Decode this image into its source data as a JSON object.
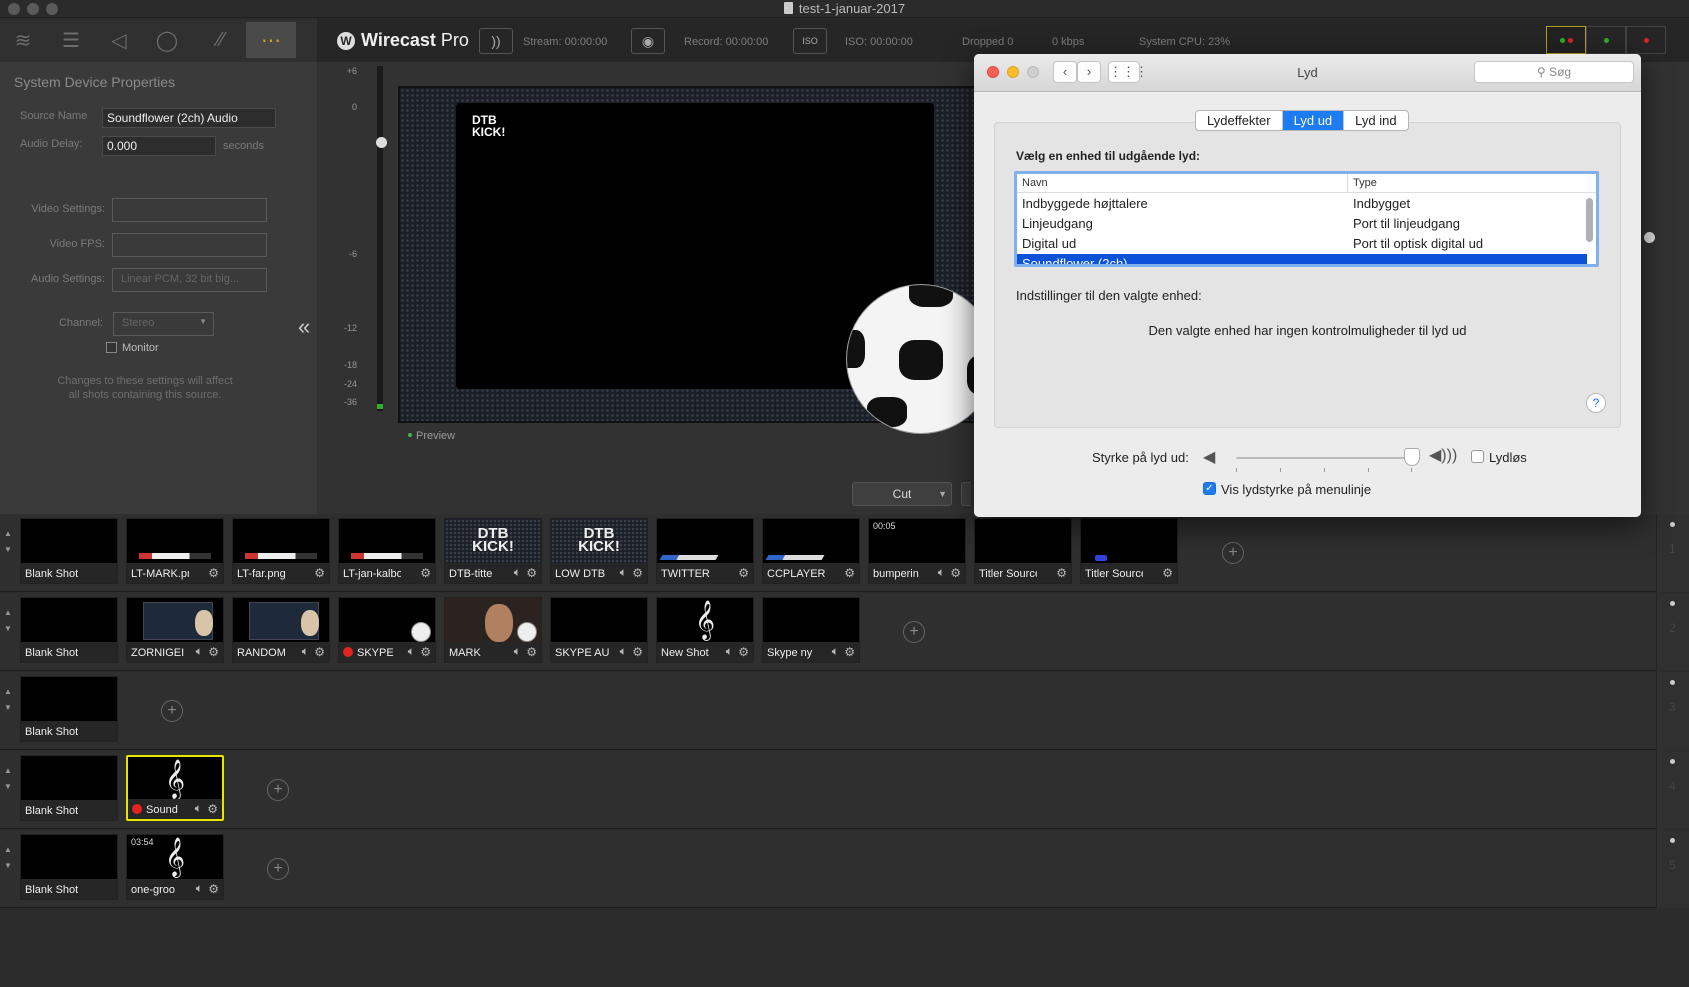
{
  "window": {
    "title": "test-1-januar-2017"
  },
  "left_panel": {
    "title": "System Device Properties",
    "source_name_label": "Source Name",
    "source_name_value": "Soundflower (2ch) Audio",
    "audio_delay_label": "Audio Delay:",
    "audio_delay_value": "0.000",
    "audio_delay_unit": "seconds",
    "video_settings_label": "Video Settings:",
    "video_fps_label": "Video FPS:",
    "audio_settings_label": "Audio Settings:",
    "audio_settings_value": "Linear PCM, 32 bit big...",
    "channel_label": "Channel:",
    "channel_value": "Stereo",
    "monitor_label": "Monitor",
    "note_line1": "Changes to these settings will affect",
    "note_line2": "all shots containing this source.",
    "collapse": "«"
  },
  "header": {
    "logo": "Wirecast",
    "logo_suffix": " Pro",
    "stream_label": "Stream:",
    "stream_time": "00:00:00",
    "record_label": "Record:",
    "record_time": "00:00:00",
    "iso_label": "ISO:",
    "iso_time": "00:00:00",
    "iso_btn": "ISO",
    "dropped": "Dropped 0",
    "kbps": "0 kbps",
    "cpu": "System CPU: 23%"
  },
  "meter": {
    "ticks": [
      {
        "label": "+6"
      },
      {
        "label": "0"
      },
      {
        "label": "-6"
      },
      {
        "label": "-12"
      },
      {
        "label": "-18"
      },
      {
        "label": "-24"
      },
      {
        "label": "-36"
      }
    ]
  },
  "preview": {
    "label": "Preview",
    "logo_line1": "DTB",
    "logo_line2": "KICK!",
    "cut_label": "Cut"
  },
  "layers": [
    {
      "number": "1",
      "shots": [
        {
          "label": "Blank Shot",
          "kind": "blank"
        },
        {
          "label": "LT-MARK.png",
          "kind": "lt"
        },
        {
          "label": "LT-far.png",
          "kind": "lt"
        },
        {
          "label": "LT-jan-kalbo",
          "kind": "lt"
        },
        {
          "label": "DTB-titte",
          "kind": "dtb",
          "logo1": "DTB",
          "logo2": "KICK!"
        },
        {
          "label": "LOW DTB",
          "kind": "dtb",
          "logo1": "DTB",
          "logo2": "KICK!"
        },
        {
          "label": "TWITTER",
          "kind": "tw"
        },
        {
          "label": "CCPLAYERS",
          "kind": "tw"
        },
        {
          "label": "bumperin",
          "kind": "timed",
          "time": "00:05"
        },
        {
          "label": "Titler Source",
          "kind": "plain"
        },
        {
          "label": "Titler Source",
          "kind": "blue"
        }
      ]
    },
    {
      "number": "2",
      "shots": [
        {
          "label": "Blank Shot",
          "kind": "blank"
        },
        {
          "label": "ZORNIGEI",
          "kind": "screen"
        },
        {
          "label": "RANDOM",
          "kind": "screen"
        },
        {
          "label": "SKYPE",
          "kind": "skype",
          "rec": true
        },
        {
          "label": "MARK",
          "kind": "person"
        },
        {
          "label": "SKYPE AU",
          "kind": "plain"
        },
        {
          "label": "New Shot",
          "kind": "music"
        },
        {
          "label": "Skype ny",
          "kind": "plain"
        }
      ]
    },
    {
      "number": "3",
      "shots": [
        {
          "label": "Blank Shot",
          "kind": "blank"
        }
      ]
    },
    {
      "number": "4",
      "shots": [
        {
          "label": "Blank Shot",
          "kind": "blank"
        },
        {
          "label": "Sound",
          "kind": "music",
          "rec": true,
          "selected": true
        }
      ]
    },
    {
      "number": "5",
      "shots": [
        {
          "label": "Blank Shot",
          "kind": "blank"
        },
        {
          "label": "one-groo",
          "kind": "music",
          "time": "03:54"
        }
      ]
    }
  ],
  "dialog": {
    "title": "Lyd",
    "search_placeholder": "Søg",
    "tabs": [
      {
        "label": "Lydeffekter",
        "active": false
      },
      {
        "label": "Lyd ud",
        "active": true
      },
      {
        "label": "Lyd ind",
        "active": false
      }
    ],
    "heading": "Vælg en enhed til udgående lyd:",
    "col_name": "Navn",
    "col_type": "Type",
    "devices": [
      {
        "name": "Indbyggede højttalere",
        "type": "Indbygget",
        "selected": false
      },
      {
        "name": "Linjeudgang",
        "type": "Port til linjeudgang",
        "selected": false
      },
      {
        "name": "Digital ud",
        "type": "Port til optisk digital ud",
        "selected": false
      },
      {
        "name": "Soundflower (2ch)",
        "type": "",
        "selected": true
      }
    ],
    "settings_heading": "Indstillinger til den valgte enhed:",
    "no_controls": "Den valgte enhed har ingen kontrolmuligheder til lyd ud",
    "help": "?",
    "volume_label": "Styrke på lyd ud:",
    "volume_level": 0.95,
    "mute_label": "Lydløs",
    "mute_checked": false,
    "show_volume_label": "Vis lydstyrke på menulinje",
    "show_volume_checked": true
  }
}
